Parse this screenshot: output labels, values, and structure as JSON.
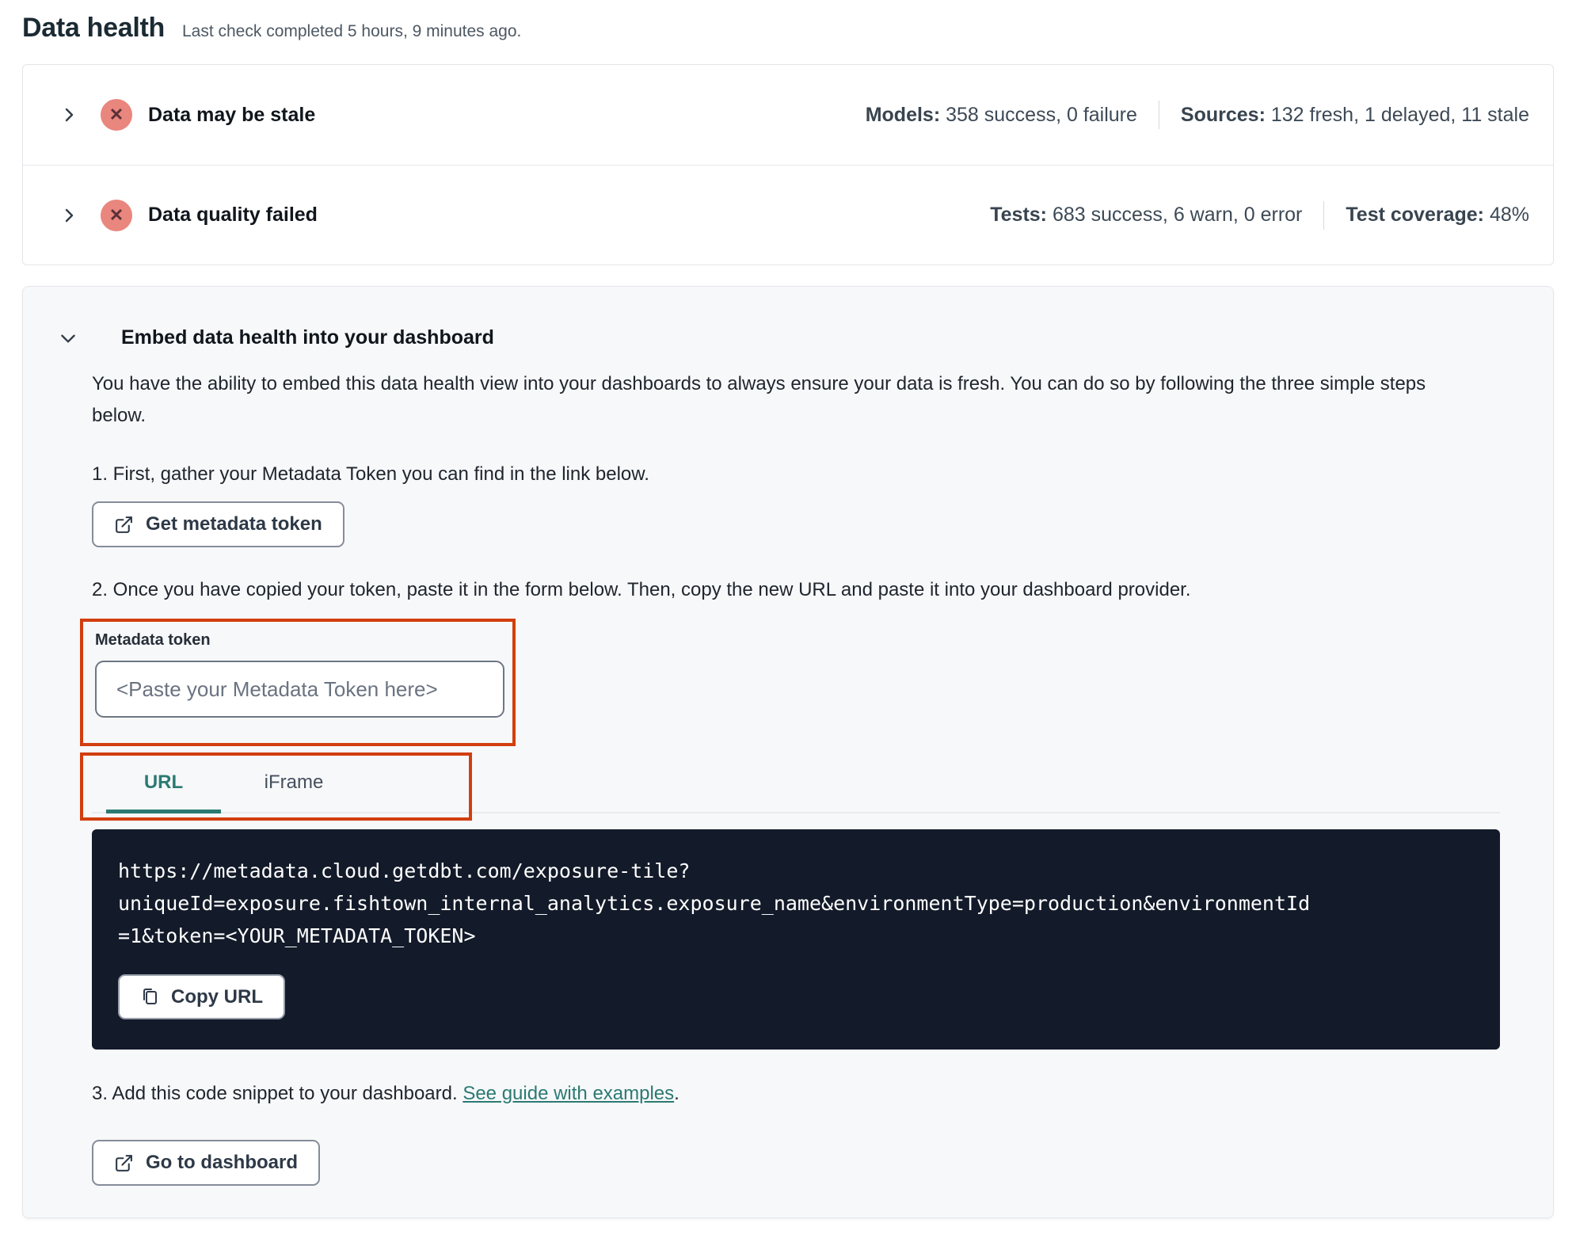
{
  "page": {
    "title": "Data health",
    "subtitle": "Last check completed 5 hours, 9 minutes ago."
  },
  "status_rows": [
    {
      "label": "Data may be stale",
      "status_icon": "error-x-icon",
      "stats": [
        {
          "label": "Models:",
          "value": "358 success, 0 failure"
        },
        {
          "label": "Sources:",
          "value": "132 fresh, 1 delayed, 11 stale"
        }
      ]
    },
    {
      "label": "Data quality failed",
      "status_icon": "error-x-icon",
      "stats": [
        {
          "label": "Tests:",
          "value": "683 success, 6 warn, 0 error"
        },
        {
          "label": "Test coverage:",
          "value": "48%"
        }
      ]
    }
  ],
  "embed": {
    "title": "Embed data health into your dashboard",
    "description": "You have the ability to embed this data health view into your dashboards to always ensure your data is fresh. You can do so by following the three simple steps below.",
    "step1": {
      "text": "1. First, gather your Metadata Token you can find in the link below.",
      "button_label": "Get metadata token"
    },
    "step2": {
      "text": "2. Once you have copied your token, paste it in the form below. Then, copy the new URL and paste it into your dashboard provider.",
      "token_field": {
        "label": "Metadata token",
        "placeholder": "<Paste your Metadata Token here>",
        "value": ""
      },
      "tabs": [
        {
          "label": "URL",
          "active": true
        },
        {
          "label": "iFrame",
          "active": false
        }
      ],
      "code_url": "https://metadata.cloud.getdbt.com/exposure-tile?uniqueId=exposure.fishtown_internal_analytics.exposure_name&environmentType=production&environmentId=1&token=<YOUR_METADATA_TOKEN>",
      "copy_button_label": "Copy URL"
    },
    "step3": {
      "text_before_link": "3. Add this code snippet to your dashboard. ",
      "link_label": "See guide with examples",
      "text_after_link": ".",
      "button_label": "Go to dashboard"
    }
  },
  "icons": {
    "error_glyph": "✕"
  },
  "colors": {
    "accent_teal": "#2B7A72",
    "annotation_red": "#D23E0E",
    "status_error_bg": "#E9867D",
    "status_error_glyph": "#5C3038",
    "code_block_bg": "#131A29",
    "card_bg": "#F7F8FA"
  }
}
